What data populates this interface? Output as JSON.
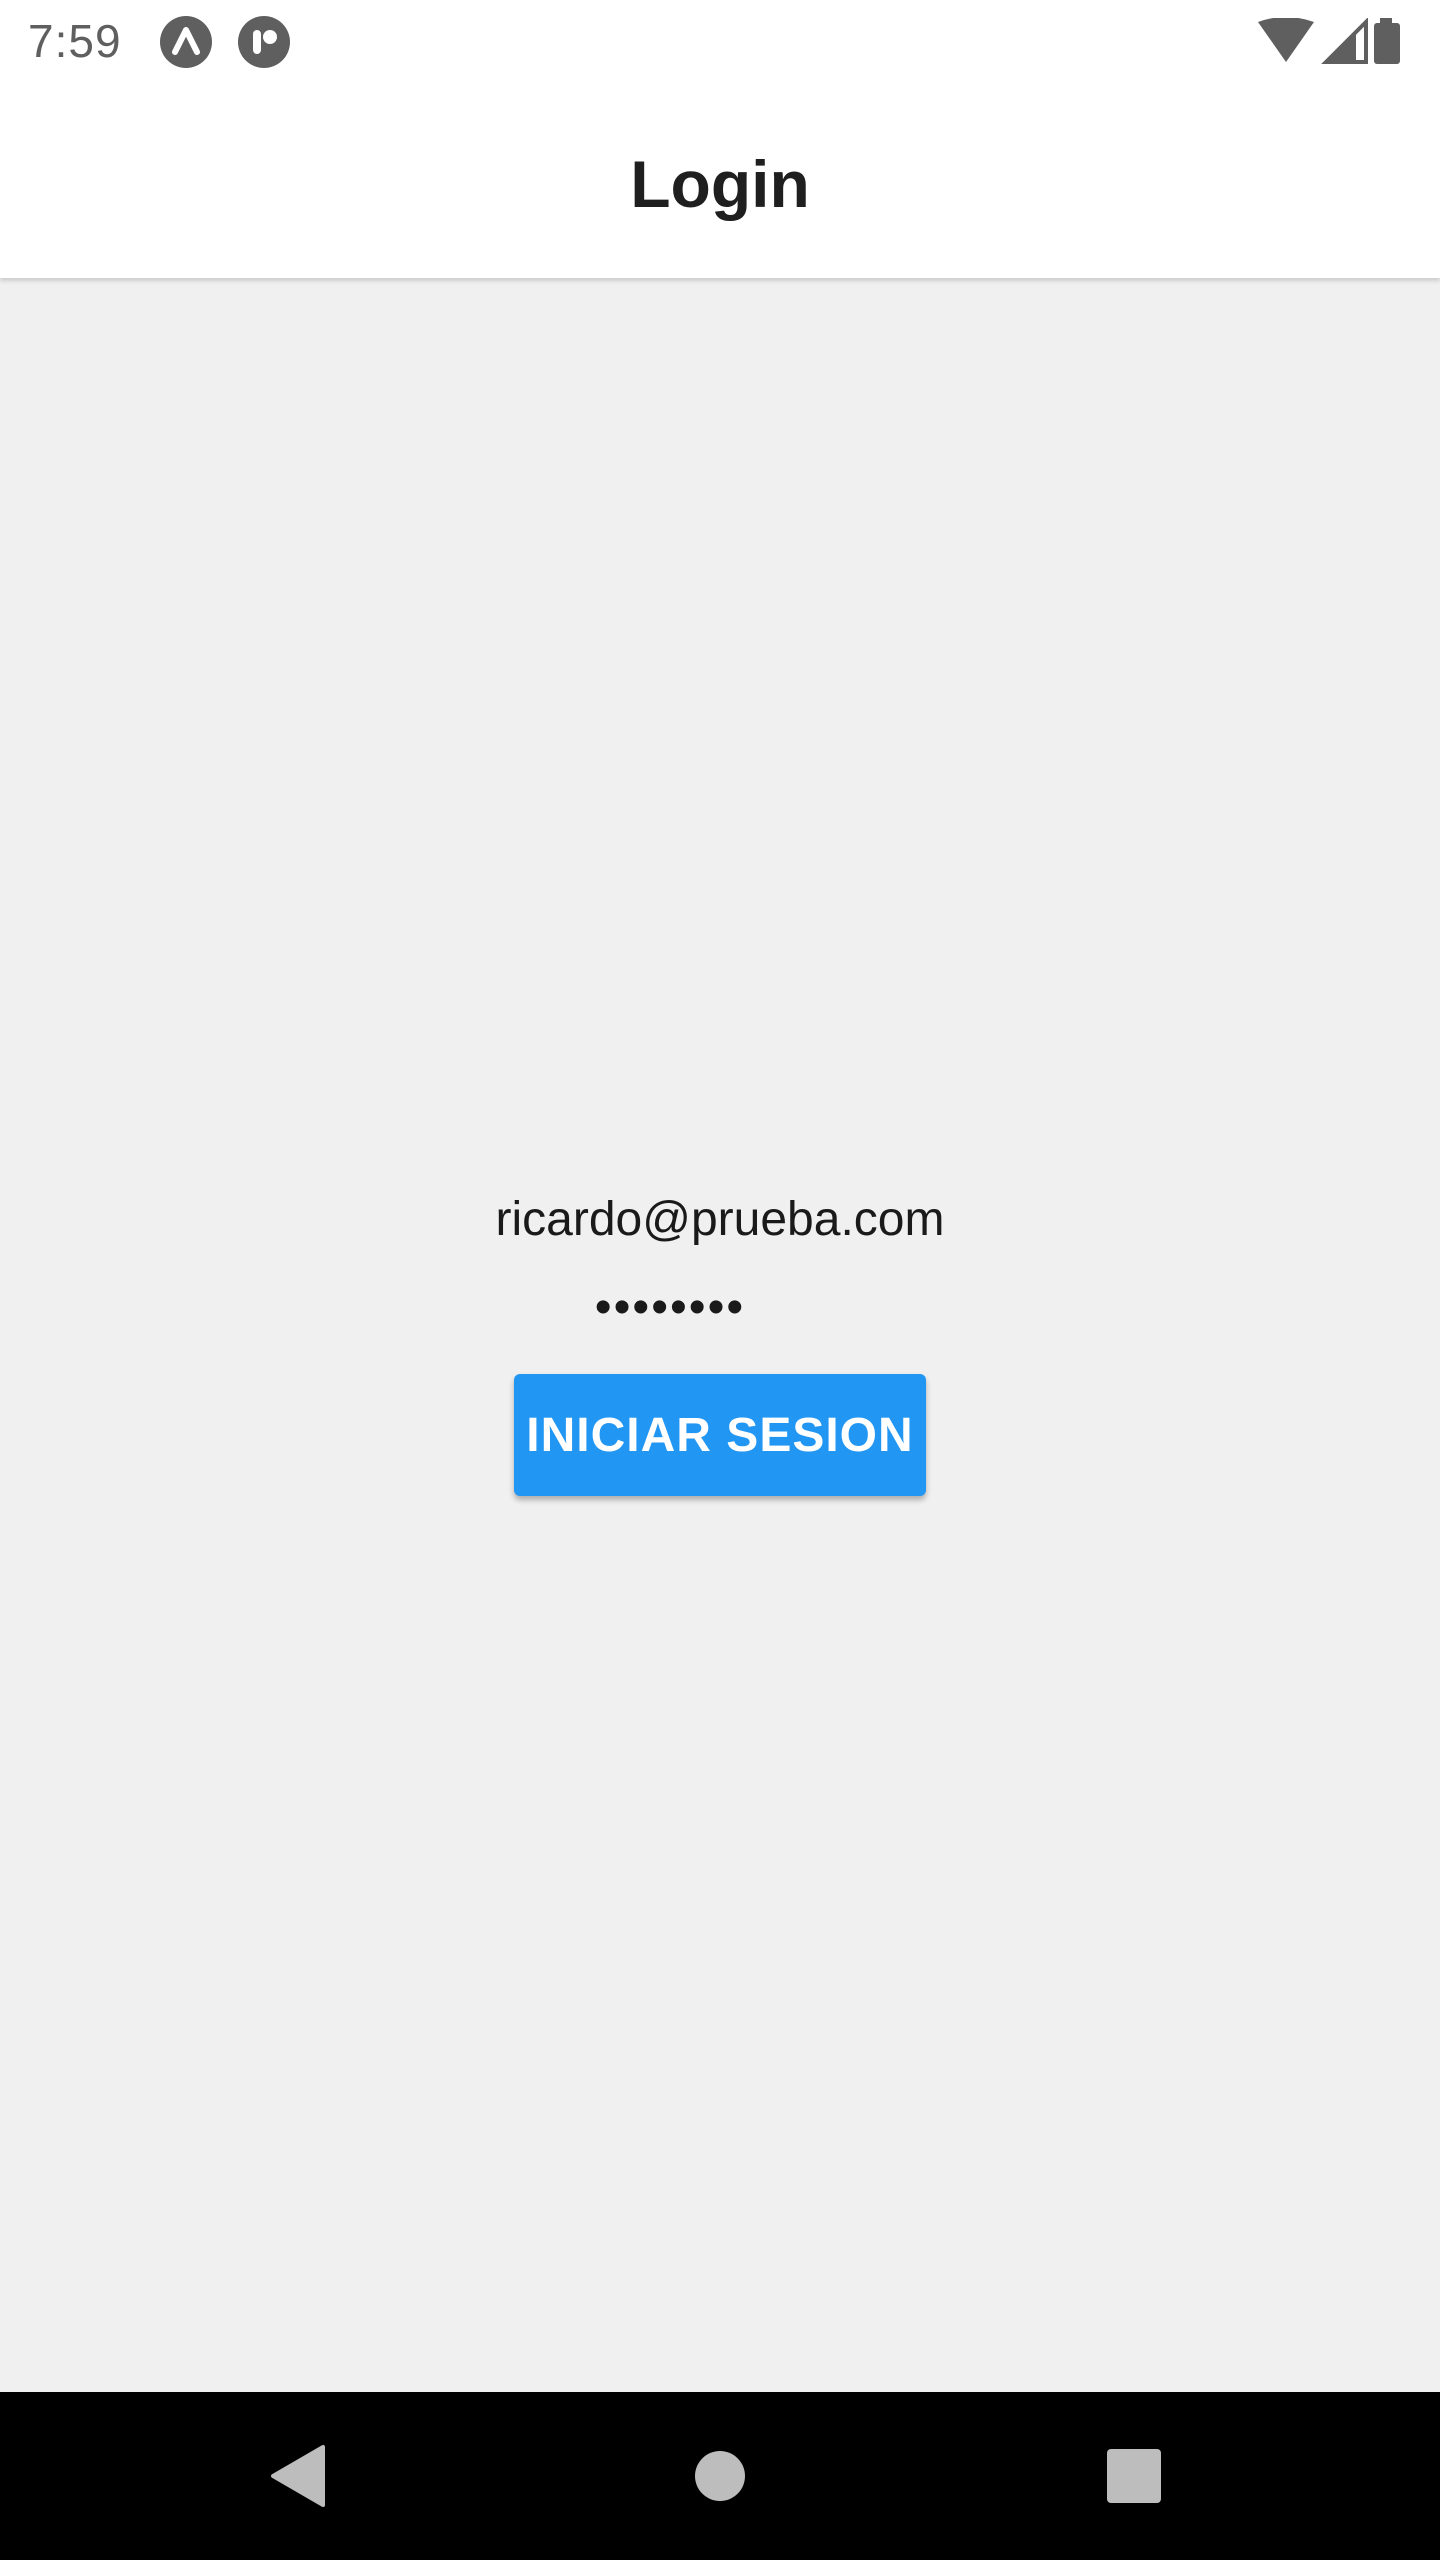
{
  "status_bar": {
    "time": "7:59",
    "notification_icons": [
      "expo-icon",
      "app-icon"
    ],
    "system_icons": [
      "wifi-icon",
      "signal-icon",
      "battery-icon"
    ]
  },
  "app_bar": {
    "title": "Login"
  },
  "form": {
    "email_value": "ricardo@prueba.com",
    "password_value": "••••••••",
    "submit_label": "INICIAR SESION"
  },
  "nav_bar": {
    "buttons": [
      "back-icon",
      "home-icon",
      "recents-icon"
    ]
  },
  "colors": {
    "accent": "#2196f3",
    "background": "#f0f0f0",
    "app_bar": "#ffffff",
    "nav_bar": "#000000"
  }
}
